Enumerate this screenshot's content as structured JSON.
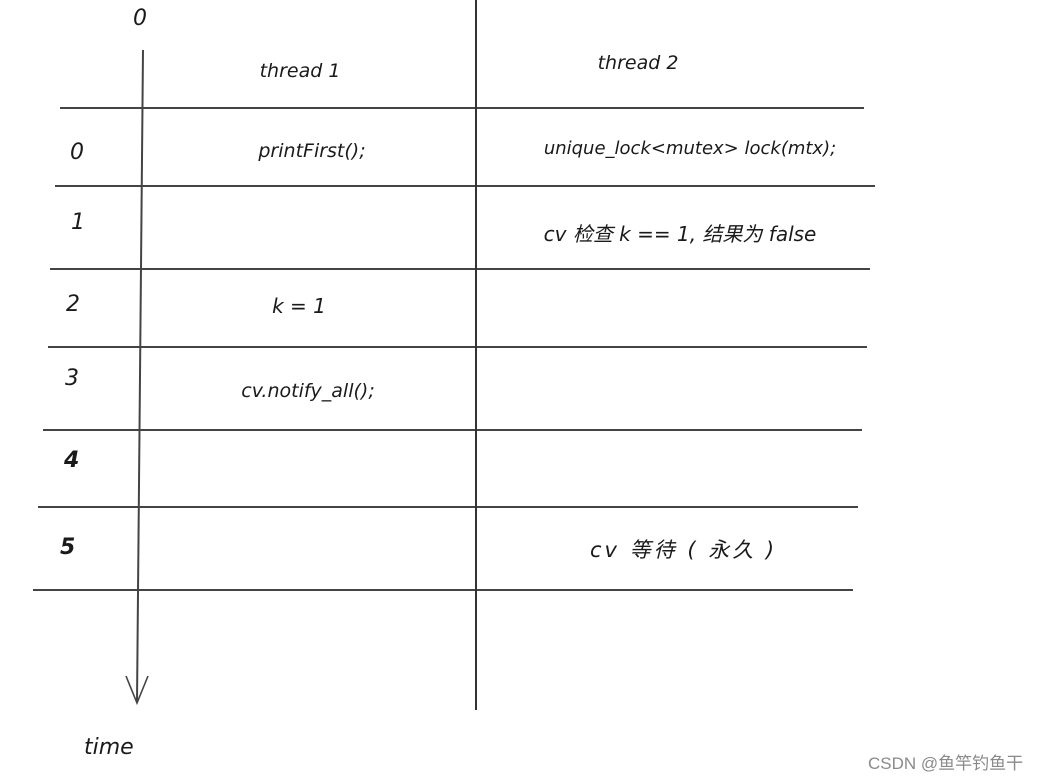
{
  "diagram": {
    "axis": {
      "origin_label": "0",
      "axis_label": "time"
    },
    "columns": [
      {
        "header": "thread 1"
      },
      {
        "header": "thread 2"
      }
    ],
    "rows": [
      {
        "time": "0",
        "thread1": "printFirst();",
        "thread2": "unique_lock<mutex> lock(mtx);"
      },
      {
        "time": "1",
        "thread1": "",
        "thread2": "cv 检查 k == 1, 结果为 false"
      },
      {
        "time": "2",
        "thread1": "k = 1",
        "thread2": ""
      },
      {
        "time": "3",
        "thread1": "cv.notify_all();",
        "thread2": ""
      },
      {
        "time": "4",
        "thread1": "",
        "thread2": ""
      },
      {
        "time": "5",
        "thread1": "",
        "thread2": "cv 等待 ( 永久 )"
      }
    ]
  },
  "watermark": "CSDN @鱼竿钓鱼干"
}
